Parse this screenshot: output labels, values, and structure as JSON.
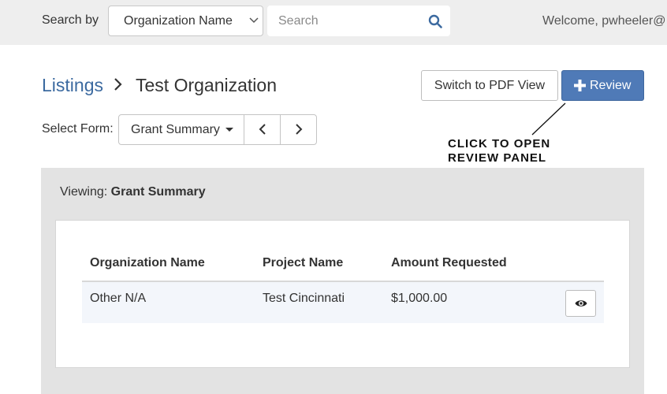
{
  "header": {
    "search_by_label": "Search by",
    "search_field_value": "Organization Name",
    "search_placeholder": "Search",
    "welcome_text": "Welcome, pwheeler@"
  },
  "breadcrumb": {
    "parent": "Listings",
    "current": "Test Organization"
  },
  "actions": {
    "pdf_label": "Switch to PDF View",
    "review_label": "Review"
  },
  "annotation": {
    "line1": "CLICK TO OPEN",
    "line2": "REVIEW PANEL"
  },
  "form_selector": {
    "label": "Select Form:",
    "selected": "Grant Summary"
  },
  "panel": {
    "viewing_prefix": "Viewing: ",
    "viewing_form": "Grant Summary",
    "columns": [
      "Organization Name",
      "Project Name",
      "Amount Requested"
    ],
    "rows": [
      {
        "organization": "Other N/A",
        "project": "Test Cincinnati",
        "amount": "$1,000.00"
      }
    ]
  },
  "colors": {
    "accent": "#4f7ab7",
    "link": "#3c6aa0",
    "topbar": "#eeeeee",
    "panel_bg": "#e3e3e3",
    "row_bg": "#f3f6fb"
  },
  "icons": [
    "chevron-down-icon",
    "search-icon",
    "chevron-right-icon",
    "plus-icon",
    "chevron-left-icon",
    "eye-icon"
  ]
}
